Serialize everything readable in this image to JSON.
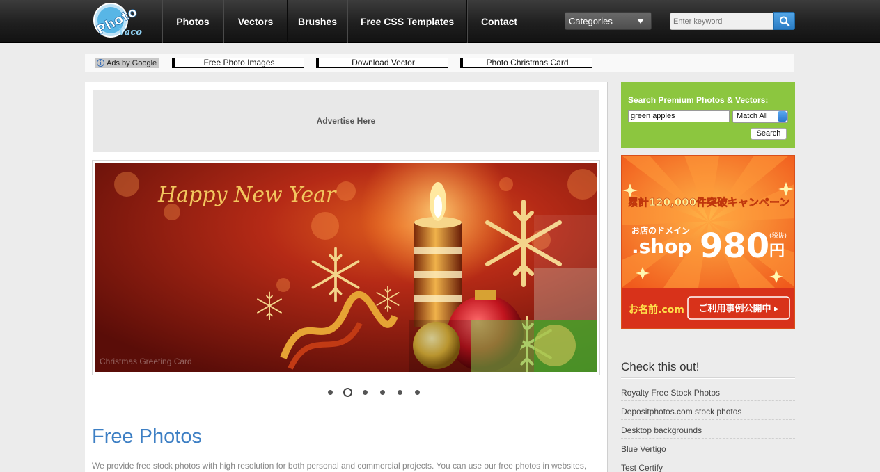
{
  "header": {
    "logo_line1": "Photo",
    "logo_line2": "Vaco",
    "nav": [
      {
        "label": "Photos"
      },
      {
        "label": "Vectors"
      },
      {
        "label": "Brushes"
      },
      {
        "label": "Free CSS Templates"
      },
      {
        "label": "Contact"
      }
    ],
    "categories_label": "Categories",
    "search_placeholder": "Enter keyword",
    "search_icon": "search-icon"
  },
  "ads_strip": {
    "ads_by": "Ads by Google",
    "links": [
      "Free Photo Images",
      "Download Vector",
      "Photo Christmas Card"
    ]
  },
  "main": {
    "advert_label": "Advertise Here",
    "slide": {
      "headline": "Happy New Year",
      "caption": "Christmas Greeting Card",
      "dot_count": 6,
      "active_dot": 2
    },
    "title": "Free Photos",
    "intro": "We provide free stock photos with high resolution for both personal and commercial projects. You can use our free photos in websites,"
  },
  "sidebar": {
    "premium": {
      "title": "Search Premium Photos & Vectors:",
      "query": "green apples",
      "match": "Match All",
      "button": "Search"
    },
    "banner": {
      "line1": "累計120,000件突破キャンペーン",
      "line2": "お店のドメイン",
      "domain": ".shop",
      "price": "980",
      "yen": "円",
      "tax": "(税抜)",
      "brand": "お名前.com",
      "cta": "ご利用事例公開中 ▸"
    },
    "check_title": "Check this out!",
    "check_items": [
      "Royalty Free Stock Photos",
      "Depositphotos.com stock photos",
      "Desktop backgrounds",
      "Blue Vertigo",
      "Test Certify"
    ]
  },
  "colors": {
    "topbar": "#1f1f1f",
    "accent_blue": "#3d7fc4",
    "premium_green": "#8cc63f",
    "banner_orange": "#f07a28"
  }
}
